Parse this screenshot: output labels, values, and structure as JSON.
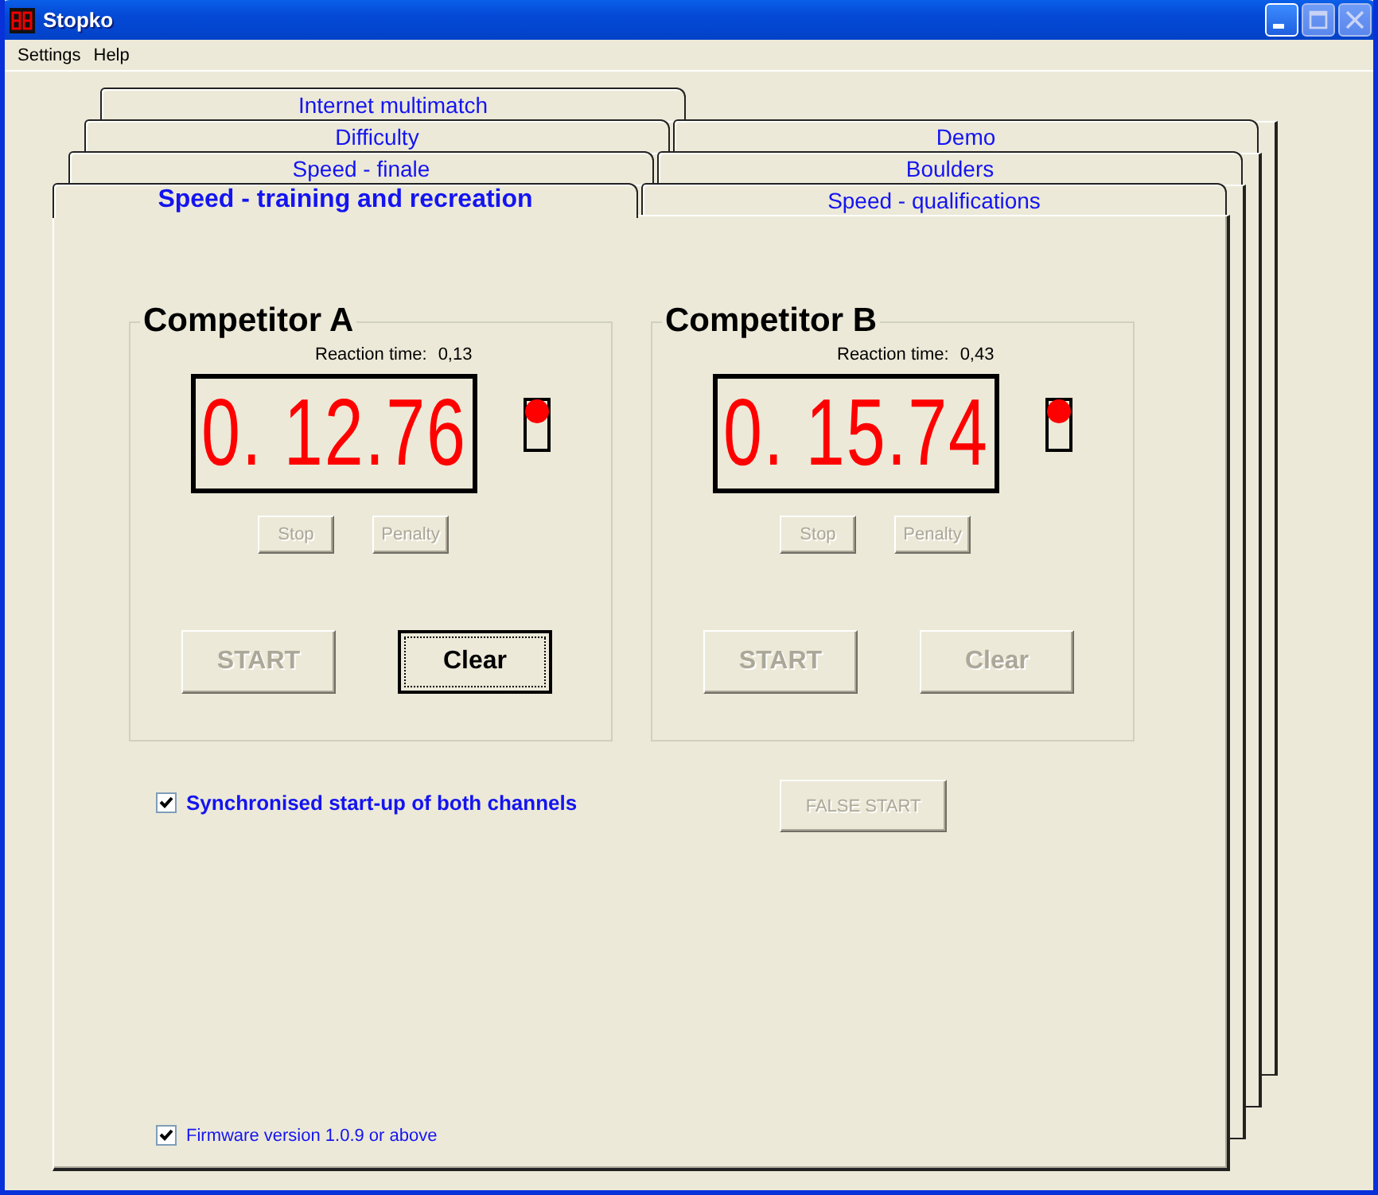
{
  "window": {
    "title": "Stopko"
  },
  "menu": [
    "Settings",
    "Help"
  ],
  "tab_rows": [
    [
      {
        "label": "Internet multimatch",
        "selected": false
      }
    ],
    [
      {
        "label": "Difficulty",
        "selected": false
      },
      {
        "label": "Demo",
        "selected": false
      }
    ],
    [
      {
        "label": "Speed - finale",
        "selected": false
      },
      {
        "label": "Boulders",
        "selected": false
      }
    ],
    [
      {
        "label": "Speed - training and recreation",
        "selected": true
      },
      {
        "label": "Speed - qualifications",
        "selected": false
      }
    ]
  ],
  "competitors": [
    {
      "name": "Competitor A",
      "reaction_label": "Reaction time:",
      "reaction_value": "0,13",
      "time": "0. 12.76",
      "signal_on": true,
      "small_buttons": [
        {
          "label": "Stop",
          "disabled": true
        },
        {
          "label": "Penalty",
          "disabled": true
        }
      ],
      "large_buttons": [
        {
          "label": "START",
          "disabled": true,
          "focused": false
        },
        {
          "label": "Clear",
          "disabled": false,
          "focused": true
        }
      ]
    },
    {
      "name": "Competitor B",
      "reaction_label": "Reaction time:",
      "reaction_value": "0,43",
      "time": "0. 15.74",
      "signal_on": true,
      "small_buttons": [
        {
          "label": "Stop",
          "disabled": true
        },
        {
          "label": "Penalty",
          "disabled": true
        }
      ],
      "large_buttons": [
        {
          "label": "START",
          "disabled": true,
          "focused": false
        },
        {
          "label": "Clear",
          "disabled": true,
          "focused": false
        }
      ]
    }
  ],
  "sync": {
    "label": "Synchronised start-up of both channels",
    "checked": true
  },
  "false_start": {
    "label": "FALSE START",
    "disabled": true
  },
  "firmware": {
    "label": "Firmware version 1.0.9 or above",
    "checked": true
  }
}
